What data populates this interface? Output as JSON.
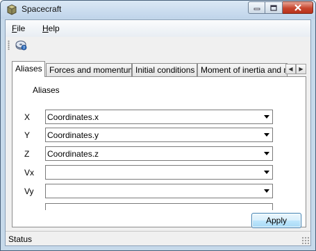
{
  "window": {
    "title": "Spacecraft",
    "icon": "box-cube-icon"
  },
  "menu": {
    "file_prefix": "F",
    "file_rest": "ile",
    "help_prefix": "H",
    "help_rest": "elp"
  },
  "toolbar": {
    "icon": "disk-help-icon"
  },
  "tabs": [
    {
      "label": "Aliases",
      "active": true
    },
    {
      "label": "Forces and momentums",
      "active": false
    },
    {
      "label": "Initial conditions",
      "active": false
    },
    {
      "label": "Moment of inertia and mass",
      "active": false
    }
  ],
  "panel": {
    "group_label": "Aliases",
    "rows": [
      {
        "label": "X",
        "value": "Coordinates.x"
      },
      {
        "label": "Y",
        "value": "Coordinates.y"
      },
      {
        "label": "Z",
        "value": "Coordinates.z"
      },
      {
        "label": "Vx",
        "value": ""
      },
      {
        "label": "Vy",
        "value": ""
      }
    ]
  },
  "apply_label": "Apply",
  "status": "Status",
  "colors": {
    "title_bar": "#c6d9ea",
    "close_button": "#c7462e",
    "apply_border": "#3c7fb1"
  }
}
